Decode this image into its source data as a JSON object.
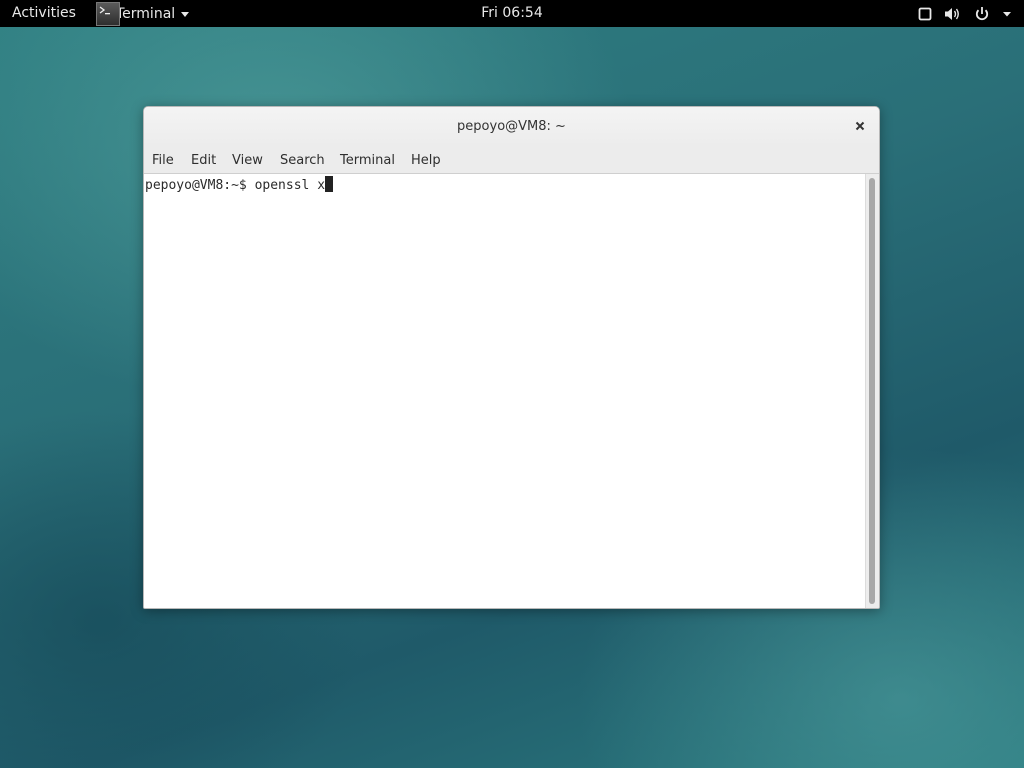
{
  "topbar": {
    "activities_label": "Activities",
    "app_menu_label": "Terminal",
    "clock": "Fri 06:54",
    "status_icons": [
      "screen-icon",
      "volume-icon",
      "power-icon",
      "chevron-down-icon"
    ]
  },
  "window": {
    "title": "pepoyo@VM8: ~",
    "close_icon": "close-icon",
    "menu": [
      "File",
      "Edit",
      "View",
      "Search",
      "Terminal",
      "Help"
    ]
  },
  "terminal": {
    "prompt": "pepoyo@VM8:~$ ",
    "command": "openssl x"
  },
  "colors": {
    "topbar_bg": "#000000",
    "desktop_teal": "#2a6f78",
    "window_bg": "#ffffff"
  }
}
